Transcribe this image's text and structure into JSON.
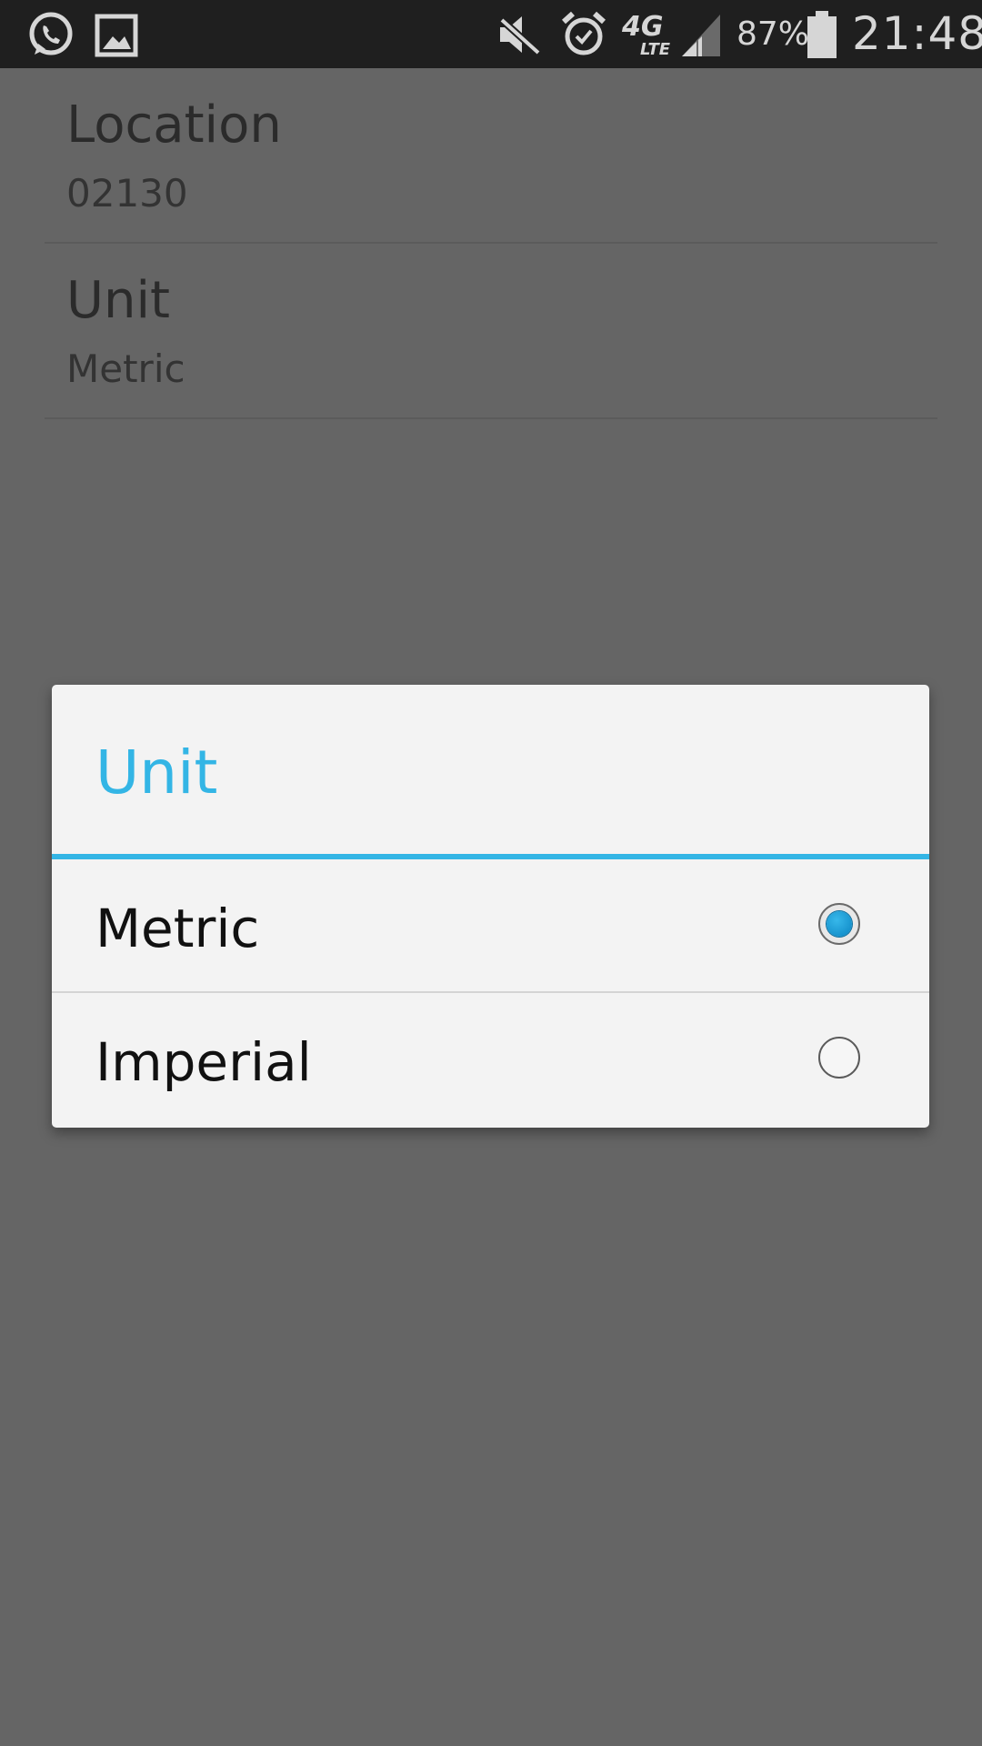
{
  "status_bar": {
    "icons": [
      "whatsapp-icon",
      "gallery-icon",
      "mute-icon",
      "alarm-icon",
      "network-4g-lte-icon",
      "signal-icon",
      "battery-icon"
    ],
    "network_label": "4G",
    "network_sub_label": "LTE",
    "battery_percent": "87%",
    "battery_level": 0.87,
    "time": "21:48"
  },
  "settings": {
    "items": [
      {
        "title": "Location",
        "summary": "02130"
      },
      {
        "title": "Unit",
        "summary": "Metric"
      }
    ]
  },
  "dialog": {
    "title": "Unit",
    "accent_color": "#33b5e5",
    "options": [
      {
        "label": "Metric",
        "selected": true
      },
      {
        "label": "Imperial",
        "selected": false
      }
    ]
  }
}
